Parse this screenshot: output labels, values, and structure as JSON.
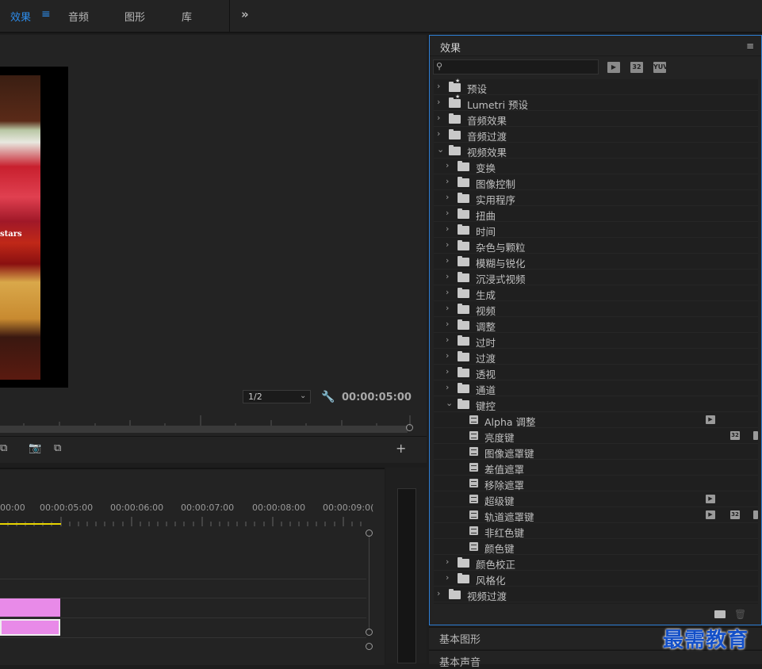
{
  "workspace_tabs": [
    {
      "label": "效果",
      "active": true
    },
    {
      "label": "音频",
      "active": false
    },
    {
      "label": "图形",
      "active": false
    },
    {
      "label": "库",
      "active": false
    }
  ],
  "more_glyph": "»",
  "program_monitor": {
    "frame_text": "stars",
    "zoom_level": "1/2",
    "timecode": "00:00:05:00"
  },
  "timeline": {
    "ruler": [
      "00:00",
      "00:00:05:00",
      "00:00:06:00",
      "00:00:07:00",
      "00:00:08:00",
      "00:00:09:0("
    ]
  },
  "effects_panel": {
    "title": "效果",
    "search": {
      "value": "",
      "placeholder": ""
    },
    "filter_badges": [
      "▶",
      "32",
      "YUV"
    ],
    "tree": [
      {
        "label": "预设",
        "kind": "star-folder",
        "level": 0,
        "expanded": false
      },
      {
        "label": "Lumetri 预设",
        "kind": "star-folder",
        "level": 0,
        "expanded": false
      },
      {
        "label": "音频效果",
        "kind": "folder",
        "level": 0,
        "expanded": false
      },
      {
        "label": "音频过渡",
        "kind": "folder",
        "level": 0,
        "expanded": false
      },
      {
        "label": "视频效果",
        "kind": "folder",
        "level": 0,
        "expanded": true
      },
      {
        "label": "变换",
        "kind": "folder",
        "level": 1,
        "expanded": false
      },
      {
        "label": "图像控制",
        "kind": "folder",
        "level": 1,
        "expanded": false
      },
      {
        "label": "实用程序",
        "kind": "folder",
        "level": 1,
        "expanded": false
      },
      {
        "label": "扭曲",
        "kind": "folder",
        "level": 1,
        "expanded": false
      },
      {
        "label": "时间",
        "kind": "folder",
        "level": 1,
        "expanded": false
      },
      {
        "label": "杂色与颗粒",
        "kind": "folder",
        "level": 1,
        "expanded": false
      },
      {
        "label": "模糊与锐化",
        "kind": "folder",
        "level": 1,
        "expanded": false
      },
      {
        "label": "沉浸式视频",
        "kind": "folder",
        "level": 1,
        "expanded": false
      },
      {
        "label": "生成",
        "kind": "folder",
        "level": 1,
        "expanded": false
      },
      {
        "label": "视频",
        "kind": "folder",
        "level": 1,
        "expanded": false
      },
      {
        "label": "调整",
        "kind": "folder",
        "level": 1,
        "expanded": false
      },
      {
        "label": "过时",
        "kind": "folder",
        "level": 1,
        "expanded": false
      },
      {
        "label": "过渡",
        "kind": "folder",
        "level": 1,
        "expanded": false
      },
      {
        "label": "透视",
        "kind": "folder",
        "level": 1,
        "expanded": false
      },
      {
        "label": "通道",
        "kind": "folder",
        "level": 1,
        "expanded": false
      },
      {
        "label": "键控",
        "kind": "folder",
        "level": 1,
        "expanded": true
      },
      {
        "label": "Alpha 调整",
        "kind": "effect",
        "level": 2,
        "badges": [
          "accel"
        ]
      },
      {
        "label": "亮度键",
        "kind": "effect",
        "level": 2,
        "badges": [
          "32"
        ]
      },
      {
        "label": "图像遮罩键",
        "kind": "effect",
        "level": 2,
        "badges": []
      },
      {
        "label": "差值遮罩",
        "kind": "effect",
        "level": 2,
        "badges": []
      },
      {
        "label": "移除遮罩",
        "kind": "effect",
        "level": 2,
        "badges": []
      },
      {
        "label": "超级键",
        "kind": "effect",
        "level": 2,
        "badges": [
          "accel"
        ]
      },
      {
        "label": "轨道遮罩键",
        "kind": "effect",
        "level": 2,
        "badges": [
          "accel",
          "32"
        ]
      },
      {
        "label": "非红色键",
        "kind": "effect",
        "level": 2,
        "badges": []
      },
      {
        "label": "颜色键",
        "kind": "effect",
        "level": 2,
        "badges": []
      },
      {
        "label": "颜色校正",
        "kind": "folder",
        "level": 1,
        "expanded": false
      },
      {
        "label": "风格化",
        "kind": "folder",
        "level": 1,
        "expanded": false
      },
      {
        "label": "视频过渡",
        "kind": "folder",
        "level": 0,
        "expanded": false
      }
    ]
  },
  "bottom_panels": {
    "basic_graphics": "基本图形",
    "basic_sound": "基本声音"
  },
  "watermark": "最需教育",
  "colors": {
    "accent": "#2d8ceb",
    "playhead": "#e8d400",
    "clip": "#e88ae8"
  }
}
